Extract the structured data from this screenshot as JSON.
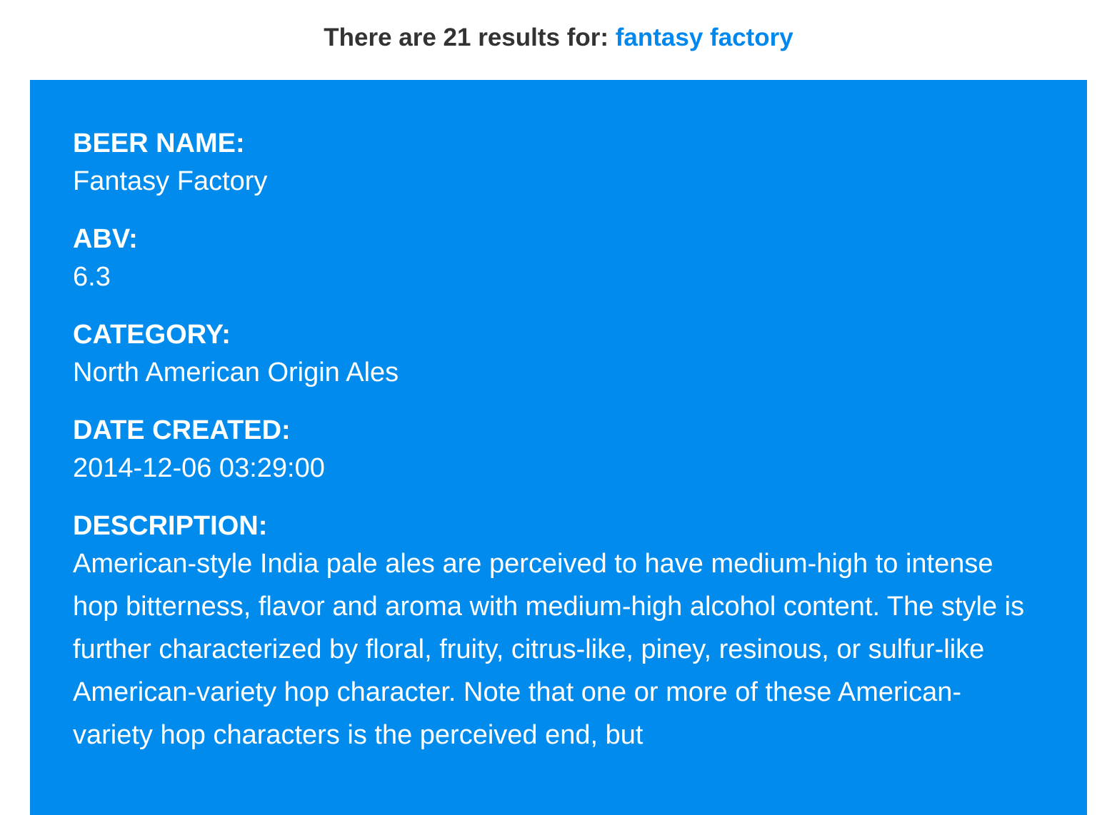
{
  "search": {
    "prefix": "There are 21 results for:",
    "query": "fantasy factory"
  },
  "result": {
    "fields": [
      {
        "label": "BEER NAME:",
        "value": "Fantasy Factory"
      },
      {
        "label": "ABV:",
        "value": "6.3"
      },
      {
        "label": "CATEGORY:",
        "value": "North American Origin Ales"
      },
      {
        "label": "DATE CREATED:",
        "value": "2014-12-06 03:29:00"
      },
      {
        "label": "DESCRIPTION:",
        "value": "American-style India pale ales are perceived to have medium-high to intense hop bitterness, flavor and aroma with medium-high alcohol content. The style is further characterized by floral, fruity, citrus-like, piney, resinous, or sulfur-like American-variety hop character. Note that one or more of these American-variety hop characters is the perceived end, but"
      }
    ]
  },
  "colors": {
    "card_background": "#008bed",
    "link": "#0088ee",
    "heading_text": "#333333"
  }
}
